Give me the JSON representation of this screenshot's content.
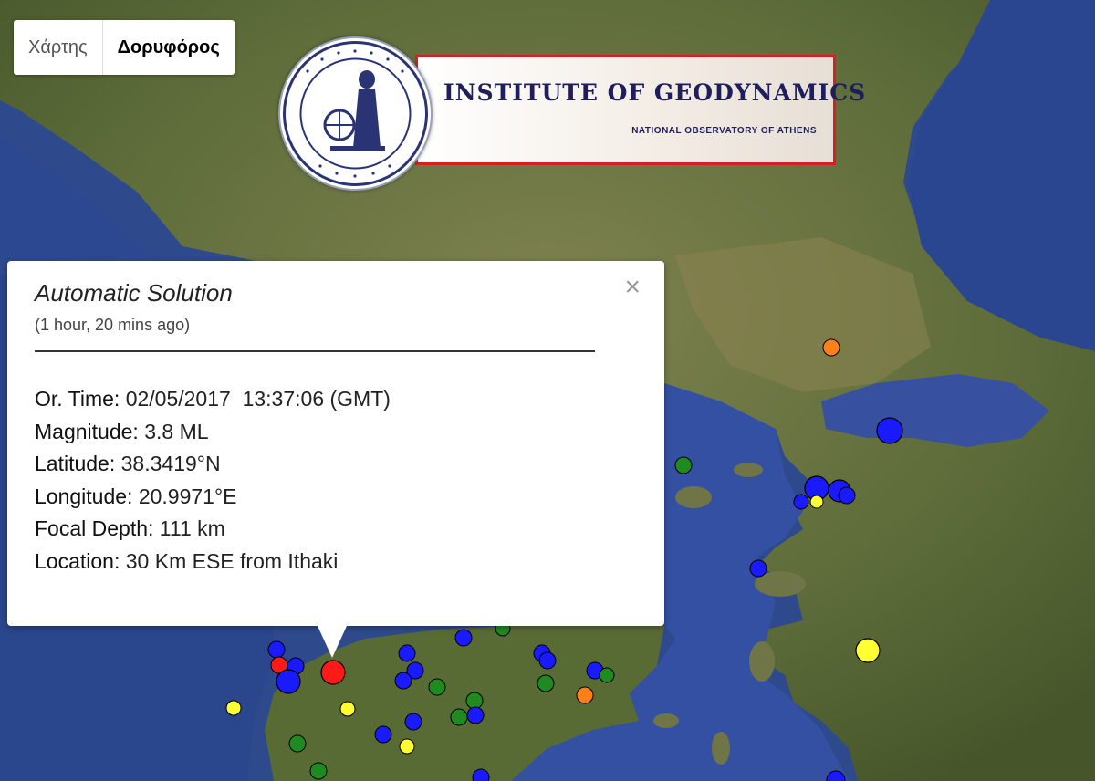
{
  "map_type": {
    "map_label": "Χάρτης",
    "satellite_label": "Δορυφόρος",
    "active": "satellite"
  },
  "logo": {
    "title_text": "INSTITUTE OF GEODYNAMICS",
    "subtitle_text": "NATIONAL OBSERVATORY OF ATHENS"
  },
  "popup": {
    "title": "Automatic Solution",
    "ago": "(1 hour, 20 mins ago)",
    "close_symbol": "×",
    "fields": [
      {
        "label": "Or. Time:",
        "value": "02/05/2017  13:37:06 (GMT)"
      },
      {
        "label": "Magnitude:",
        "value": "3.8 ML"
      },
      {
        "label": "Latitude:",
        "value": "38.3419°N"
      },
      {
        "label": "Longitude:",
        "value": "20.9971°E"
      },
      {
        "label": "Focal Depth:",
        "value": "111 km"
      },
      {
        "label": "Location:",
        "value": "30 Km ESE from Ithaki"
      }
    ]
  },
  "colors": {
    "recent_event": "#ff1a1a",
    "blue_events": "#1a1aff",
    "green_events": "#1f8a1f",
    "yellow_events": "#ffff33",
    "orange_events": "#ff7f1a",
    "sea": "#2f4a8a",
    "land": "#5d6e3a"
  }
}
